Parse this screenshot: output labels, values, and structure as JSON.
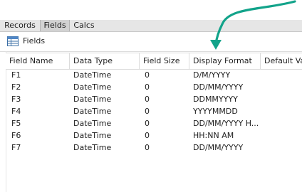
{
  "tabs": [
    {
      "label": "Records",
      "active": false
    },
    {
      "label": "Fields",
      "active": true
    },
    {
      "label": "Calcs",
      "active": false
    }
  ],
  "panel": {
    "title": "Fields",
    "icon": "table-icon"
  },
  "columns": [
    "Field Name",
    "Data Type",
    "Field Size",
    "Display Format",
    "Default Val"
  ],
  "rows": [
    [
      "F1",
      "DateTime",
      "0",
      "D/M/YYYY"
    ],
    [
      "F2",
      "DateTime",
      "0",
      "DD/MM/YYYY"
    ],
    [
      "F3",
      "DateTime",
      "0",
      "DDMMYYYY"
    ],
    [
      "F4",
      "DateTime",
      "0",
      "YYYYMMDD"
    ],
    [
      "F5",
      "DateTime",
      "0",
      "DD/MM/YYYY H..."
    ],
    [
      "F6",
      "DateTime",
      "0",
      "HH:NN AM"
    ],
    [
      "F7",
      "DateTime",
      "0",
      "DD/MM/YYYY"
    ]
  ],
  "colors": {
    "annotation_arrow": "#12a38a",
    "tab_active_bg": "#d2d2d2",
    "tab_strip_bg": "#e6e6e6"
  }
}
